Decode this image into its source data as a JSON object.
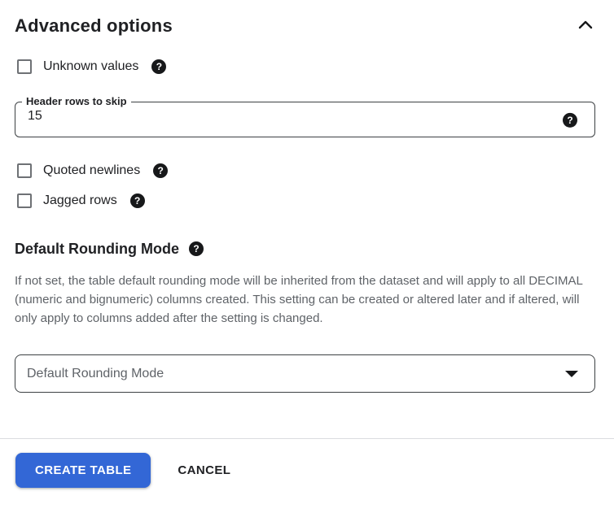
{
  "panel": {
    "title": "Advanced options"
  },
  "checkboxes": {
    "unknown_values": {
      "label": "Unknown values",
      "checked": false
    },
    "quoted_newlines": {
      "label": "Quoted newlines",
      "checked": false
    },
    "jagged_rows": {
      "label": "Jagged rows",
      "checked": false
    }
  },
  "header_rows_field": {
    "label": "Header rows to skip",
    "value": "15"
  },
  "rounding": {
    "heading": "Default Rounding Mode",
    "description": "If not set, the table default rounding mode will be inherited from the dataset and will apply to all DECIMAL (numeric and bignumeric) columns created. This setting can be created or altered later and if altered, will only apply to columns added after the setting is changed.",
    "select_placeholder": "Default Rounding Mode"
  },
  "actions": {
    "create_label": "CREATE TABLE",
    "cancel_label": "CANCEL"
  },
  "icons": {
    "help_glyph": "?",
    "collapse": "chevron-up-icon",
    "select_caret": "caret-down-icon"
  },
  "colors": {
    "primary_button": "#3367d6",
    "primary_button_text": "#ffffff",
    "body_text": "#202124",
    "secondary_text": "#5f6368",
    "divider": "#dadce0",
    "field_border": "#3c4043",
    "checkbox_border": "#6e7175",
    "help_icon_bg": "#17181a"
  }
}
